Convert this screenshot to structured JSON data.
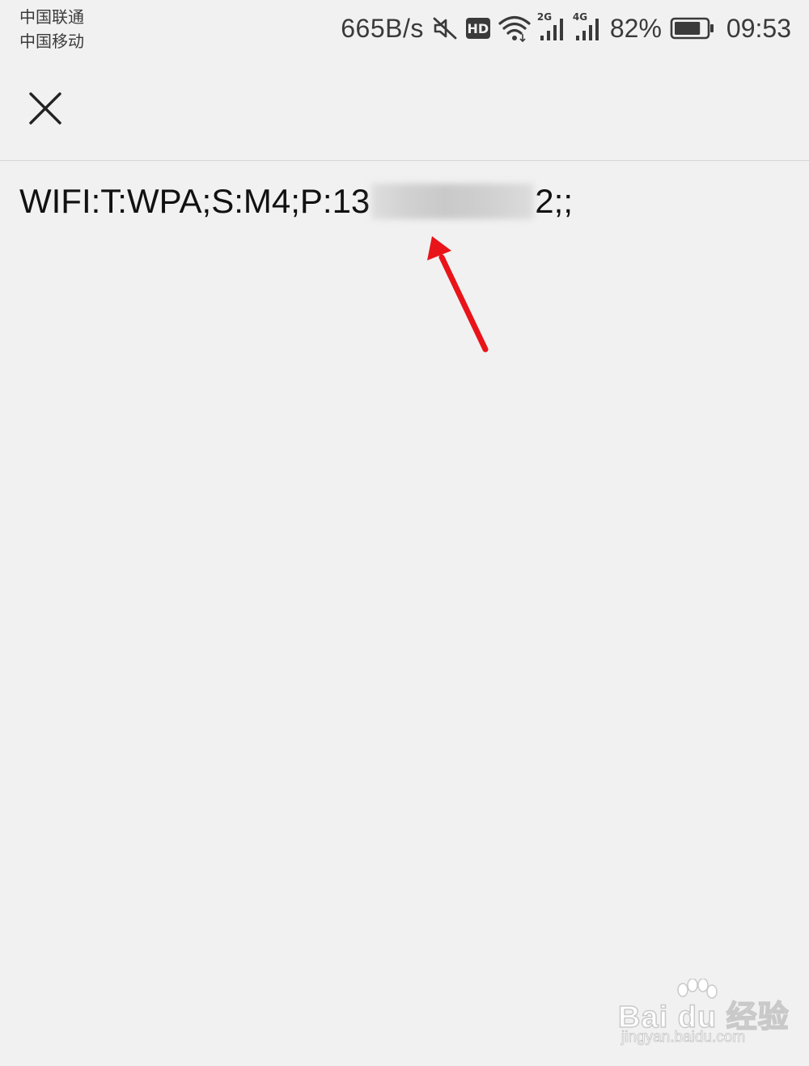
{
  "status_bar": {
    "carrier_1": "中国联通",
    "carrier_2": "中国移动",
    "net_speed": "665B/s",
    "hd_label": "HD",
    "signal_1_label": "2G",
    "signal_2_label": "4G",
    "battery_percent": "82%",
    "battery_level": 0.82,
    "time": "09:53"
  },
  "content": {
    "text_before": "WIFI:T:WPA;S:M4;P:13",
    "text_after": "2;;"
  },
  "annotation": {
    "arrow_color": "#e8141a"
  },
  "watermark": {
    "logo_text": "Bai du 经验",
    "url": "jingyan.baidu.com"
  },
  "colors": {
    "background": "#f1f1f1",
    "text": "#111111",
    "status_text": "#3a3a3a"
  }
}
